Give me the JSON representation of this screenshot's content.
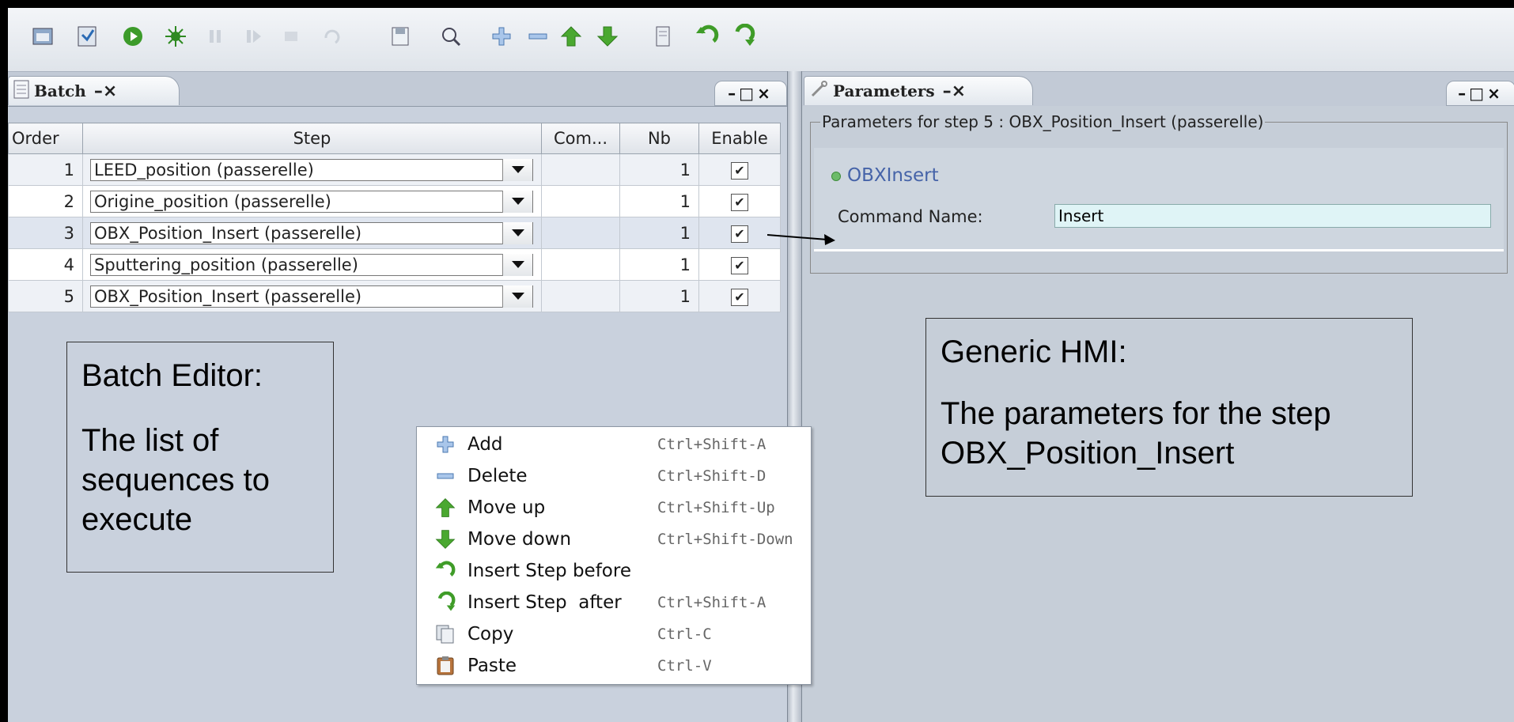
{
  "toolbar": {
    "icons": [
      "open-icon",
      "save-batch-icon",
      "run-icon",
      "debug-icon",
      "pause-icon",
      "step-icon",
      "stop-icon",
      "undo-icon",
      "save-icon",
      "inspect-icon",
      "add-icon",
      "remove-icon",
      "move-up-icon",
      "move-down-icon",
      "script-icon",
      "insert-before-icon",
      "insert-after-icon"
    ]
  },
  "batch": {
    "tab_label": "Batch",
    "tab_controls": "–×",
    "window_controls": "–□×",
    "columns": [
      "Order",
      "Step",
      "Com...",
      "Nb",
      "Enable"
    ],
    "rows": [
      {
        "order": "1",
        "step": "LEED_position (passerelle)",
        "com": "",
        "nb": "1",
        "enabled": "✔"
      },
      {
        "order": "2",
        "step": "Origine_position (passerelle)",
        "com": "",
        "nb": "1",
        "enabled": "✔"
      },
      {
        "order": "3",
        "step": "OBX_Position_Insert (passerelle)",
        "com": "",
        "nb": "1",
        "enabled": "✔"
      },
      {
        "order": "4",
        "step": "Sputtering_position (passerelle)",
        "com": "",
        "nb": "1",
        "enabled": "✔"
      },
      {
        "order": "5",
        "step": "OBX_Position_Insert (passerelle)",
        "com": "",
        "nb": "1",
        "enabled": "✔"
      }
    ]
  },
  "callout_batch": {
    "title": "Batch Editor:",
    "body": "The list of sequences to execute"
  },
  "context_menu": {
    "items": [
      {
        "label": "Add",
        "shortcut": "Ctrl+Shift-A",
        "icon": "add-icon"
      },
      {
        "label": "Delete",
        "shortcut": "Ctrl+Shift-D",
        "icon": "delete-icon"
      },
      {
        "label": "Move up",
        "shortcut": "Ctrl+Shift-Up",
        "icon": "move-up-icon"
      },
      {
        "label": "Move down",
        "shortcut": "Ctrl+Shift-Down",
        "icon": "move-down-icon"
      },
      {
        "label": "Insert Step before",
        "shortcut": "",
        "icon": "insert-before-icon"
      },
      {
        "label": "Insert Step  after",
        "shortcut": "Ctrl+Shift-A",
        "icon": "insert-after-icon"
      },
      {
        "label": "Copy",
        "shortcut": "Ctrl-C",
        "icon": "copy-icon"
      },
      {
        "label": "Paste",
        "shortcut": "Ctrl-V",
        "icon": "paste-icon"
      }
    ]
  },
  "parameters": {
    "tab_label": "Parameters",
    "tab_controls": "–×",
    "window_controls": "–□×",
    "group_label": "Parameters for step 5 : OBX_Position_Insert (passerelle)",
    "component": "OBXInsert",
    "command_label": "Command Name:",
    "command_value": "Insert"
  },
  "callout_hmi": {
    "title": "Generic HMI:",
    "body": "The parameters for the step OBX_Position_Insert"
  },
  "colors": {
    "panel_bg": "#c9d1dd",
    "accent_green": "#3a9a1a",
    "component_blue": "#4563a8",
    "input_bg": "#dff4f6"
  }
}
